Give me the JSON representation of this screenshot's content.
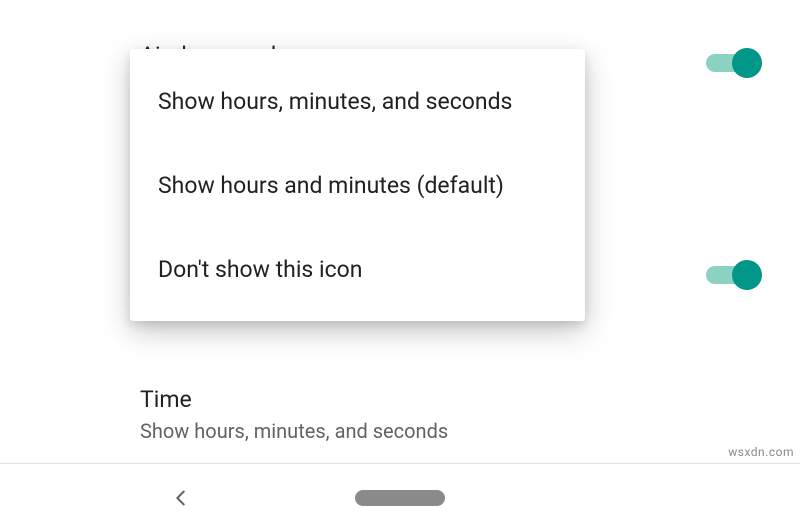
{
  "settings": {
    "airplane": {
      "title": "Airplane mode",
      "toggle_on": true
    },
    "time": {
      "title": "Time",
      "subtitle": "Show hours, minutes, and seconds"
    }
  },
  "dialog": {
    "options": [
      {
        "label": "Show hours, minutes, and seconds"
      },
      {
        "label": "Show hours and minutes (default)"
      },
      {
        "label": "Don't show this icon"
      }
    ]
  },
  "watermark": "wsxdn.com",
  "colors": {
    "accent": "#009688",
    "accent_track": "#8bd2c3"
  }
}
